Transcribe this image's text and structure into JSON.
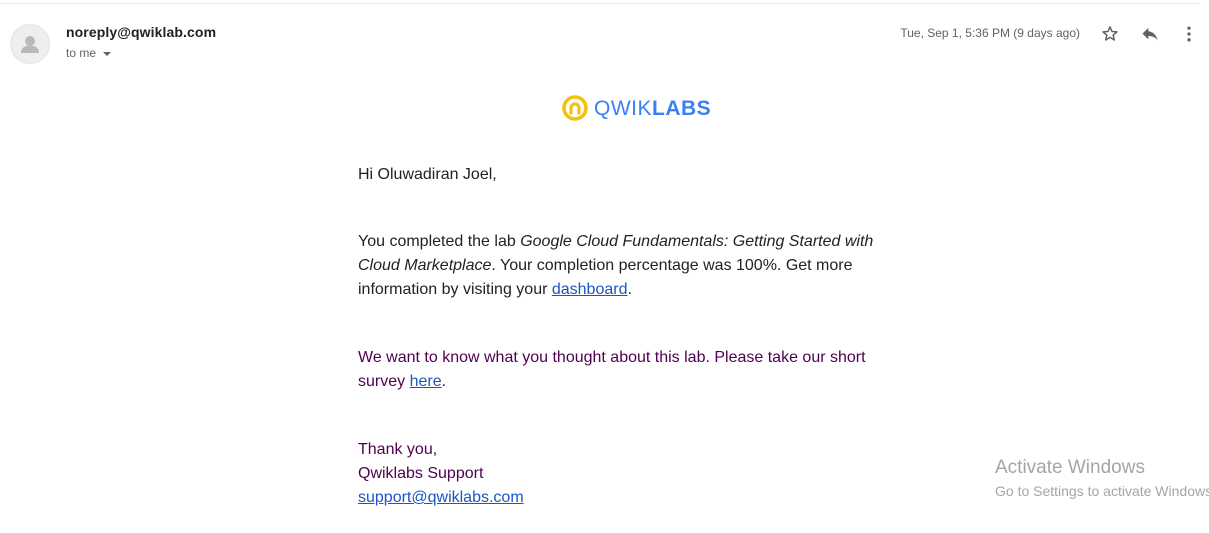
{
  "message": {
    "sender": "noreply@qwiklab.com",
    "recipient": "to me",
    "date": "Tue, Sep 1, 5:36 PM (9 days ago)"
  },
  "header_icons": [
    "star-icon",
    "reply-icon",
    "more-vert-icon"
  ],
  "logo": {
    "part1": "QWIK",
    "part2": "LABS",
    "color_blue": "#3c7ff2",
    "color_yellow": "#f4c20d"
  },
  "email": {
    "greeting": "Hi Oluwadiran Joel,",
    "p1_before": "You completed the lab ",
    "p1_lab_name": "Google Cloud Fundamentals: Getting Started with Cloud Marketplace",
    "p1_middle": ". Your completion percentage was 100%. Get more information by visiting your ",
    "p1_link": "dashboard",
    "p1_end": ".",
    "p2_before": "We want to know what you thought about this lab. Please take our short survey ",
    "p2_link": "here",
    "p2_end": ".",
    "signoff_1": "Thank you,",
    "signoff_2": "Qwiklabs Support",
    "support_email": "support@qwiklabs.com"
  },
  "watermark": {
    "title": "Activate Windows",
    "subtitle": "Go to Settings to activate Windows."
  }
}
